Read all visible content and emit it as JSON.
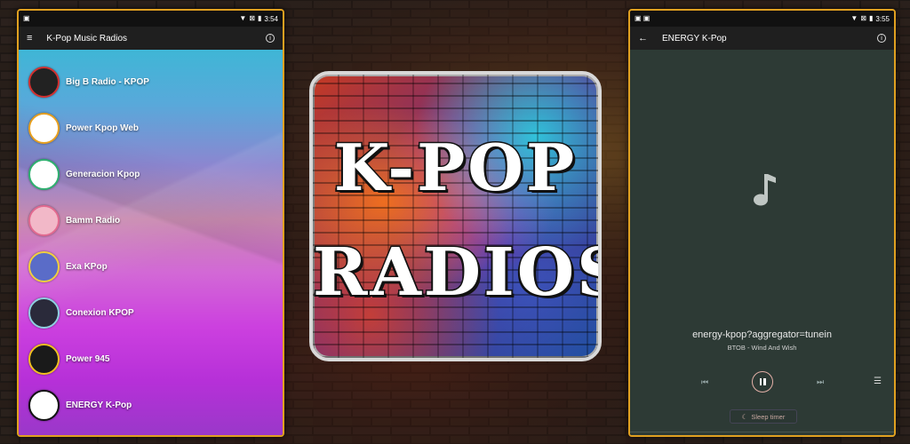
{
  "left_phone": {
    "status_time": "3:54",
    "app_title": "K-Pop Music Radios",
    "stations": [
      {
        "name": "Big B Radio - KPOP",
        "logo_color": "#222222",
        "logo_accent": "#d23030"
      },
      {
        "name": "Power Kpop Web",
        "logo_color": "#ffffff",
        "logo_accent": "#e8a020"
      },
      {
        "name": "Generacion Kpop",
        "logo_color": "#ffffff",
        "logo_accent": "#2fb070"
      },
      {
        "name": "Bamm Radio",
        "logo_color": "#f2b8c8",
        "logo_accent": "#e26a90"
      },
      {
        "name": "Exa KPop",
        "logo_color": "#5a6cc8",
        "logo_accent": "#f0d040"
      },
      {
        "name": "Conexion KPOP",
        "logo_color": "#2a2a3a",
        "logo_accent": "#8fd0e0"
      },
      {
        "name": "Power 945",
        "logo_color": "#1a1a1a",
        "logo_accent": "#f0c020"
      },
      {
        "name": "ENERGY K-Pop",
        "logo_color": "#ffffff",
        "logo_accent": "#111111"
      }
    ]
  },
  "right_phone": {
    "status_time": "3:55",
    "app_title": "ENERGY K-Pop",
    "stream_title": "energy-kpop?aggregator=tunein",
    "song_title": "BTOB - Wind And Wish",
    "sleep_timer_label": "Sleep timer",
    "accent": "#e4b0a8"
  },
  "center_logo": {
    "line1": "K-POP",
    "line2": "RADIOS"
  },
  "colors": {
    "phone_border": "#e0a020",
    "player_background": "#2d3a35"
  }
}
